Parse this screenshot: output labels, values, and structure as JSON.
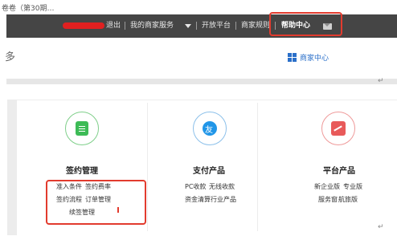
{
  "snippet_text": "卷卷（第30期…",
  "topbar": {
    "items": {
      "logout": "退出",
      "merchant_services": "我的商家服务",
      "open_platform": "开放平台",
      "merchant_rules": "商家规则",
      "help_center": "帮助中心"
    }
  },
  "glyph": "多",
  "merchant_center_link": "商家中心",
  "return_mark": "↵",
  "columns": [
    {
      "title": "签约管理",
      "links": [
        "准入条件",
        "签约费率",
        "签约流程",
        "订单管理",
        "续签管理"
      ],
      "icon": "clipboard-icon",
      "color": "#3dbb56"
    },
    {
      "title": "支付产品",
      "links": [
        "PC收款",
        "无线收款",
        "资金清算",
        "行业产品"
      ],
      "icon": "alipay-icon",
      "color": "#2196e8"
    },
    {
      "title": "平台产品",
      "links": [
        "新企业版",
        "专业版",
        "服务窗",
        "航旅版"
      ],
      "icon": "chart-icon",
      "color": "#e85a5a"
    }
  ]
}
